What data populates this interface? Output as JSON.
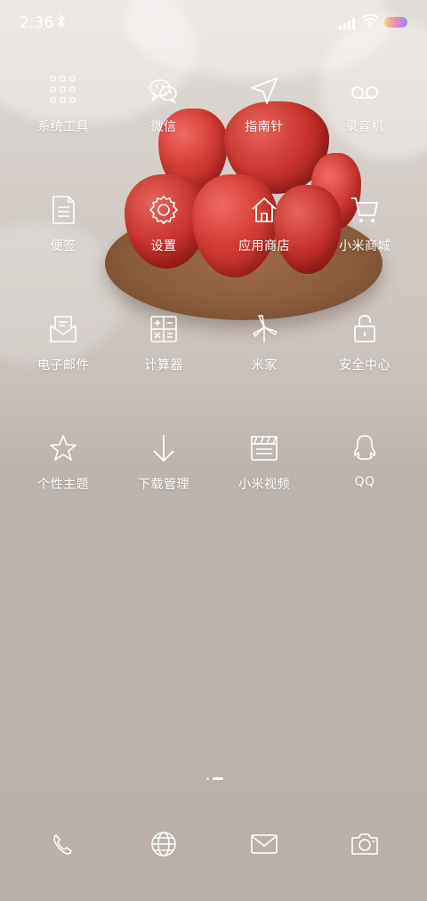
{
  "status": {
    "time": "2:36"
  },
  "apps": [
    {
      "label": "系统工具",
      "icon": "folder-grid-icon"
    },
    {
      "label": "微信",
      "icon": "wechat-icon"
    },
    {
      "label": "指南针",
      "icon": "compass-arrow-icon"
    },
    {
      "label": "录音机",
      "icon": "recorder-icon"
    },
    {
      "label": "便签",
      "icon": "note-icon"
    },
    {
      "label": "设置",
      "icon": "gear-icon"
    },
    {
      "label": "应用商店",
      "icon": "store-home-icon"
    },
    {
      "label": "小米商城",
      "icon": "cart-icon"
    },
    {
      "label": "电子邮件",
      "icon": "mail-open-icon"
    },
    {
      "label": "计算器",
      "icon": "calculator-icon"
    },
    {
      "label": "米家",
      "icon": "windmill-icon"
    },
    {
      "label": "安全中心",
      "icon": "lock-icon"
    },
    {
      "label": "个性主题",
      "icon": "star-icon"
    },
    {
      "label": "下载管理",
      "icon": "download-arrow-icon"
    },
    {
      "label": "小米视频",
      "icon": "clapperboard-icon"
    },
    {
      "label": "QQ",
      "icon": "qq-penguin-icon"
    }
  ],
  "dock": [
    {
      "icon": "phone-icon"
    },
    {
      "icon": "globe-icon"
    },
    {
      "icon": "mail-icon"
    },
    {
      "icon": "camera-icon"
    }
  ]
}
